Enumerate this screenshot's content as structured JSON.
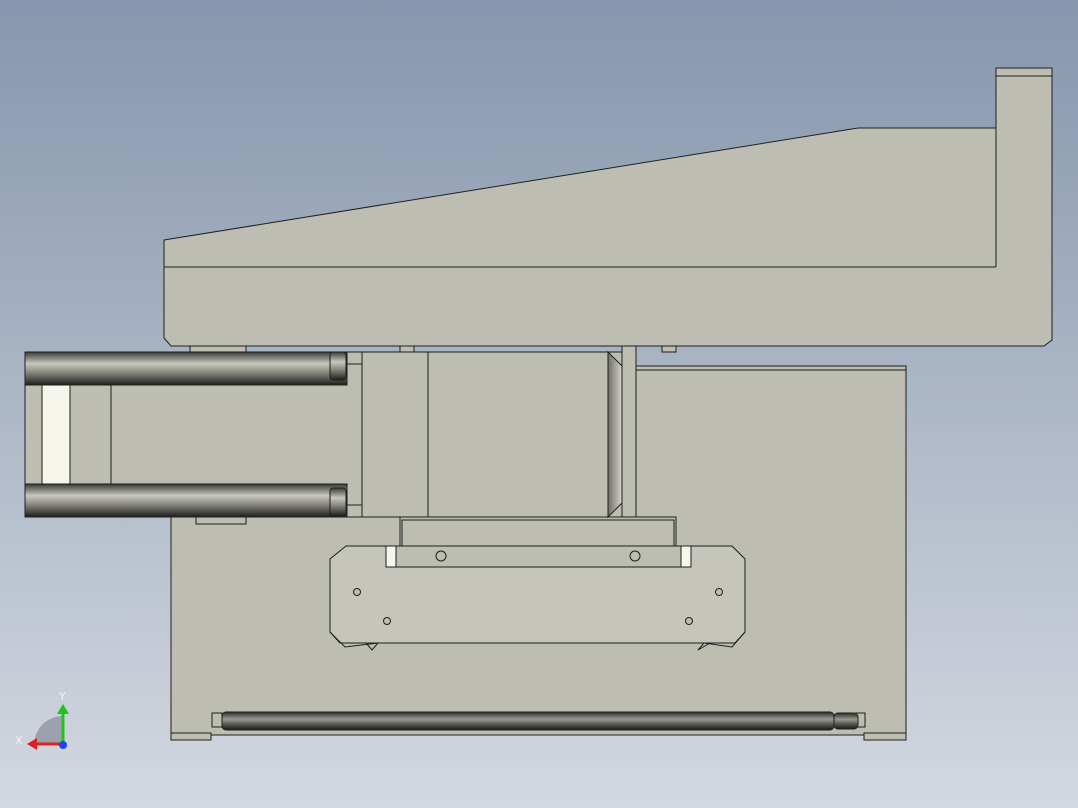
{
  "viewport": {
    "background_top": "#8696ad",
    "background_bottom": "#d3d8e0",
    "part_fill": "#bebdb2",
    "part_fill_light": "#c6c5bb",
    "edge_color": "#1f1f1f",
    "highlight_color": "#f7f6ec"
  },
  "triad": {
    "x_label": "X",
    "y_label": "Y",
    "x_axis_color": "#e02020",
    "y_axis_color": "#1fc21f",
    "z_axis_color": "#2040ff"
  }
}
